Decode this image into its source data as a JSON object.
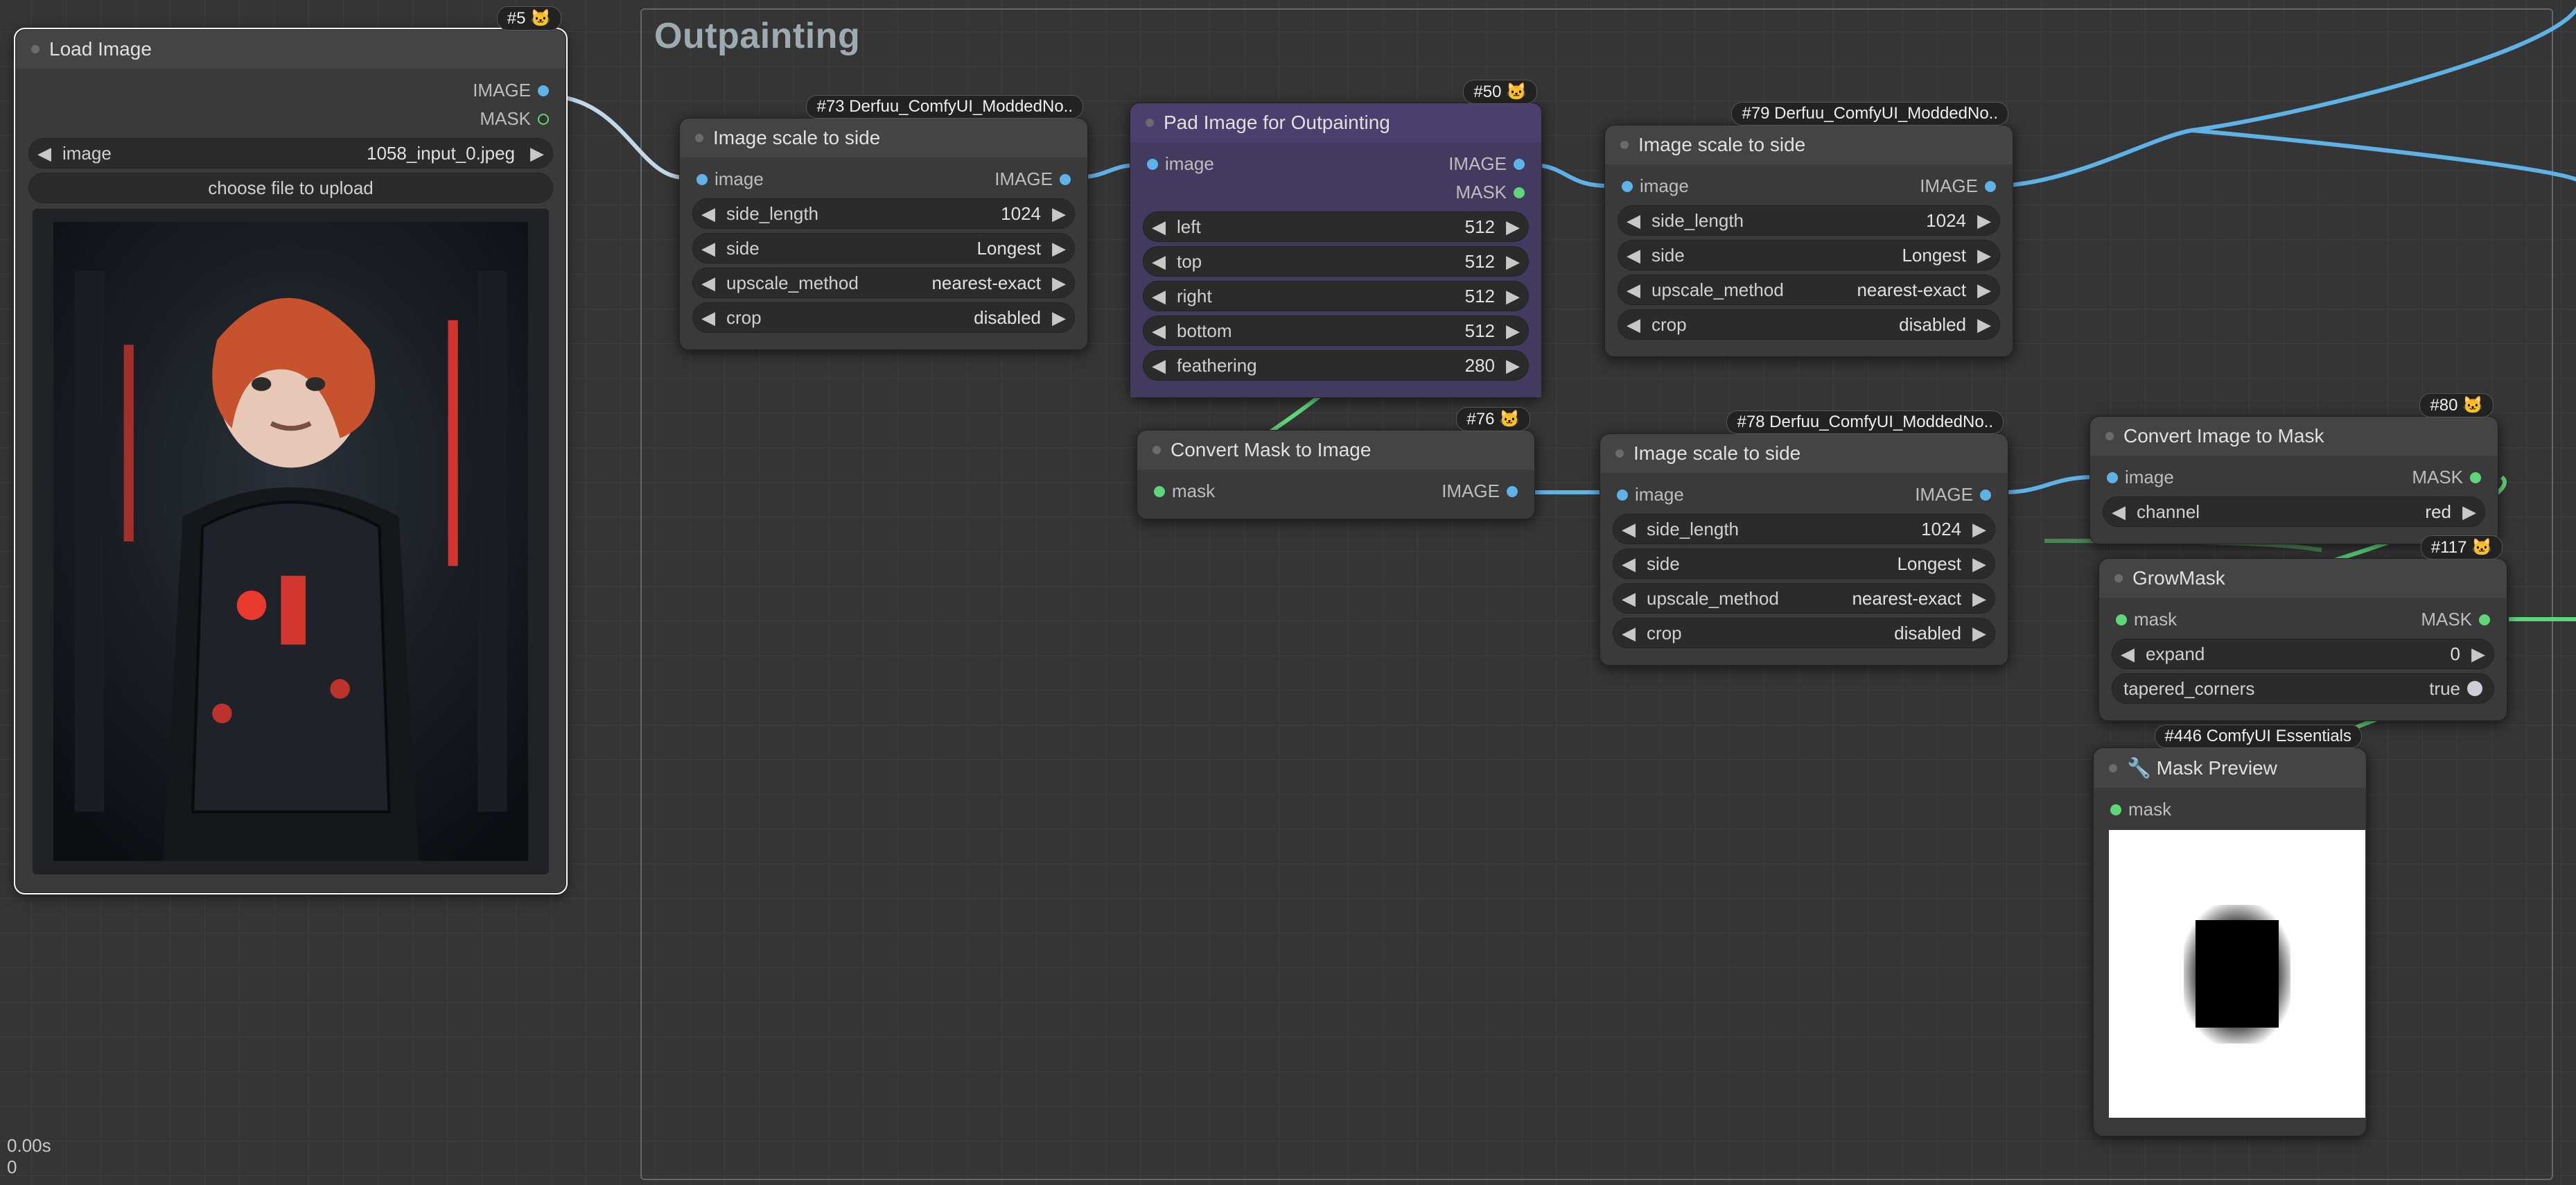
{
  "group": {
    "title": "Outpainting"
  },
  "stats": {
    "time": "0.00s",
    "count": "0"
  },
  "nodes": {
    "load_image": {
      "badge": "#5 🐱",
      "title": "Load Image",
      "out": [
        "IMAGE",
        "MASK"
      ],
      "widgets": {
        "file_label": "image",
        "file_value": "1058_input_0.jpeg",
        "upload": "choose file to upload"
      }
    },
    "scale73": {
      "badge": "#73 Derfuu_ComfyUI_ModdedNo..",
      "title": "Image scale to side",
      "in": [
        "image"
      ],
      "out": [
        "IMAGE"
      ],
      "w": {
        "side_length": "1024",
        "side": "Longest",
        "upscale_method": "nearest-exact",
        "crop": "disabled"
      }
    },
    "pad50": {
      "badge": "#50 🐱",
      "title": "Pad Image for Outpainting",
      "in": [
        "image"
      ],
      "out": [
        "IMAGE",
        "MASK"
      ],
      "w": {
        "left": "512",
        "top": "512",
        "right": "512",
        "bottom": "512",
        "feathering": "280"
      }
    },
    "scale79": {
      "badge": "#79 Derfuu_ComfyUI_ModdedNo..",
      "title": "Image scale to side",
      "in": [
        "image"
      ],
      "out": [
        "IMAGE"
      ],
      "w": {
        "side_length": "1024",
        "side": "Longest",
        "upscale_method": "nearest-exact",
        "crop": "disabled"
      }
    },
    "conv76": {
      "badge": "#76 🐱",
      "title": "Convert Mask to Image",
      "in": [
        "mask"
      ],
      "out": [
        "IMAGE"
      ]
    },
    "scale78": {
      "badge": "#78 Derfuu_ComfyUI_ModdedNo..",
      "title": "Image scale to side",
      "in": [
        "image"
      ],
      "out": [
        "IMAGE"
      ],
      "w": {
        "side_length": "1024",
        "side": "Longest",
        "upscale_method": "nearest-exact",
        "crop": "disabled"
      }
    },
    "conv80": {
      "badge": "#80 🐱",
      "title": "Convert Image to Mask",
      "in": [
        "image"
      ],
      "out": [
        "MASK"
      ],
      "w": {
        "channel": "red"
      }
    },
    "grow117": {
      "badge": "#117 🐱",
      "title": "GrowMask",
      "in": [
        "mask"
      ],
      "out": [
        "MASK"
      ],
      "w": {
        "expand": "0",
        "tapered_corners_label": "tapered_corners",
        "tapered_corners_value": "true"
      }
    },
    "preview446": {
      "badge": "#446 ComfyUI Essentials",
      "title": "🔧 Mask Preview",
      "in": [
        "mask"
      ]
    }
  },
  "labels": {
    "side_length": "side_length",
    "side": "side",
    "upscale_method": "upscale_method",
    "crop": "crop",
    "left": "left",
    "top": "top",
    "right": "right",
    "bottom": "bottom",
    "feathering": "feathering",
    "channel": "channel",
    "expand": "expand"
  }
}
